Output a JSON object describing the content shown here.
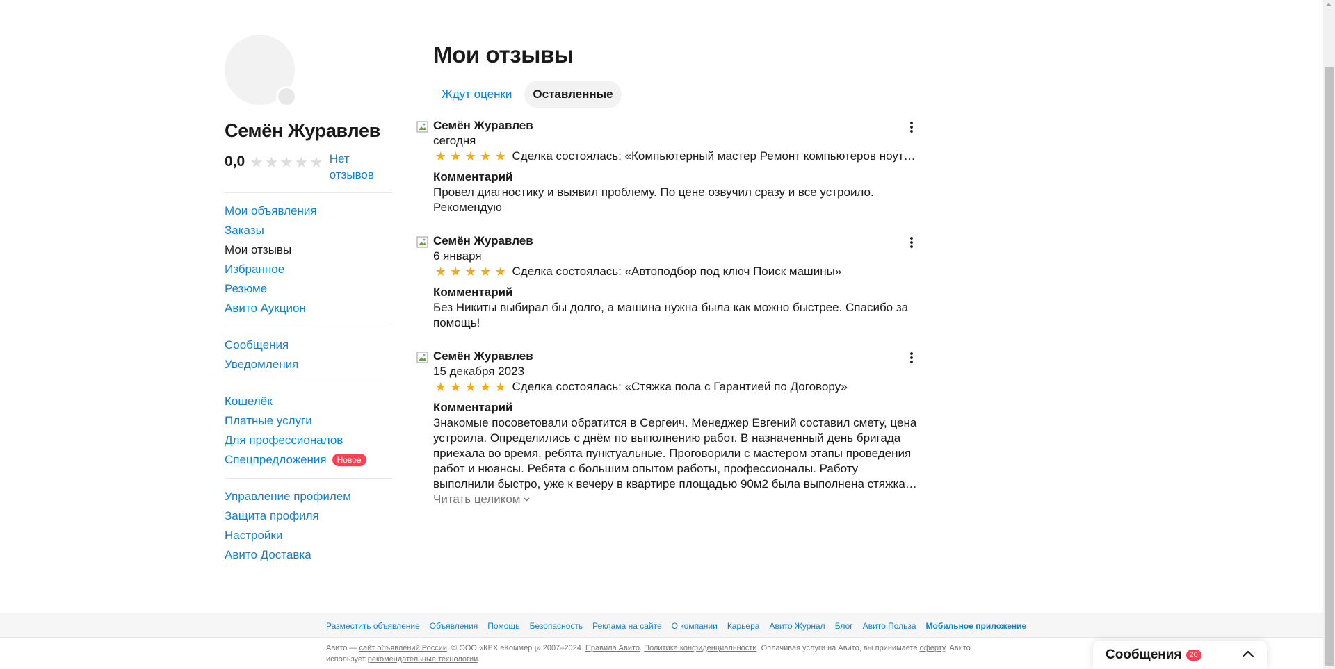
{
  "profile": {
    "name": "Семён Журавлев",
    "rating": "0,0",
    "no_reviews": "Нет отзывов"
  },
  "sidebar": {
    "groups": [
      [
        {
          "label": "Мои объявления",
          "active": false
        },
        {
          "label": "Заказы",
          "active": false
        },
        {
          "label": "Мои отзывы",
          "active": true
        },
        {
          "label": "Избранное",
          "active": false
        },
        {
          "label": "Резюме",
          "active": false
        },
        {
          "label": "Авито Аукцион",
          "active": false
        }
      ],
      [
        {
          "label": "Сообщения",
          "active": false
        },
        {
          "label": "Уведомления",
          "active": false
        }
      ],
      [
        {
          "label": "Кошелёк",
          "active": false
        },
        {
          "label": "Платные услуги",
          "active": false
        },
        {
          "label": "Для профессионалов",
          "active": false
        },
        {
          "label": "Спецпредложения",
          "active": false,
          "badge": "Новое"
        }
      ],
      [
        {
          "label": "Управление профилем",
          "active": false
        },
        {
          "label": "Защита профиля",
          "active": false
        },
        {
          "label": "Настройки",
          "active": false
        },
        {
          "label": "Авито Доставка",
          "active": false
        }
      ]
    ]
  },
  "main": {
    "title": "Мои отзывы",
    "tabs": [
      {
        "label": "Ждут оценки",
        "active": false
      },
      {
        "label": "Оставленные",
        "active": true
      }
    ],
    "comment_label": "Комментарий",
    "read_more": "Читать целиком",
    "reviews": [
      {
        "author": "Семён Журавлев",
        "date": "сегодня",
        "stars": 5,
        "deal": "Сделка состоялась: «Компьютерный мастер Ремонт компьютеров ноутбуков»",
        "comment": "Провел диагностику и выявил проблему. По цене озвучил сразу и все устроило. Рекомендую",
        "truncated": false
      },
      {
        "author": "Семён Журавлев",
        "date": "6 января",
        "stars": 5,
        "deal": "Сделка состоялась: «Автоподбор под ключ Поиск машины»",
        "comment": "Без Никиты выбирал бы долго, а машина нужна была как можно быстрее. Спасибо за помощь!",
        "truncated": false
      },
      {
        "author": "Семён Журавлев",
        "date": "15 декабря 2023",
        "stars": 5,
        "deal": "Сделка состоялась: «Стяжка пола с Гарантией по Договору»",
        "comment": "Знакомые посоветовали обратится в Сергеич. Менеджер Евгений составил смету, цена устроила. Определились с днём по выполнению работ. В назначенный день бригада приехала во время, ребята пунктуальные. Проговорили с мастером этапы проведения работ и нюансы. Ребята с большим опытом работы, профессионалы. Работу выполнили быстро, уже к вечеру в квартире площадью 90м2 была выполнена стяжка. Отличное…",
        "truncated": true
      }
    ]
  },
  "footer": {
    "links": [
      {
        "label": "Разместить объявление",
        "strong": false
      },
      {
        "label": "Объявления",
        "strong": false
      },
      {
        "label": "Помощь",
        "strong": false
      },
      {
        "label": "Безопасность",
        "strong": false
      },
      {
        "label": "Реклама на сайте",
        "strong": false
      },
      {
        "label": "О компании",
        "strong": false
      },
      {
        "label": "Карьера",
        "strong": false
      },
      {
        "label": "Авито Журнал",
        "strong": false
      },
      {
        "label": "Блог",
        "strong": false
      },
      {
        "label": "Авито Польза",
        "strong": false
      },
      {
        "label": "Мобильное приложение",
        "strong": true
      }
    ],
    "legal": {
      "t1": "Авито — ",
      "l1": "сайт объявлений России",
      "t2": ". © ООО «КЕХ еКоммерц» 2007–2024. ",
      "l2": "Правила Авито",
      "t3": ". ",
      "l3": "Политика конфиденциальности",
      "t4": ". Оплачивая услуги на Авито, вы принимаете ",
      "l4": "оферту",
      "t5": ". Авито использует ",
      "l5": "рекомендательные технологии",
      "t6": "."
    }
  },
  "messenger": {
    "title": "Сообщения",
    "count": "20"
  },
  "colors": {
    "link": "#0a82d8",
    "star_active": "#ffa800",
    "star_inactive": "#dddddd",
    "badge": "#ff4053"
  },
  "icons": {
    "kebab": "more-vertical-icon",
    "chevron_up": "chevron-up-icon",
    "chevron_down": "chevron-down-icon",
    "broken_image": "broken-image-icon"
  }
}
